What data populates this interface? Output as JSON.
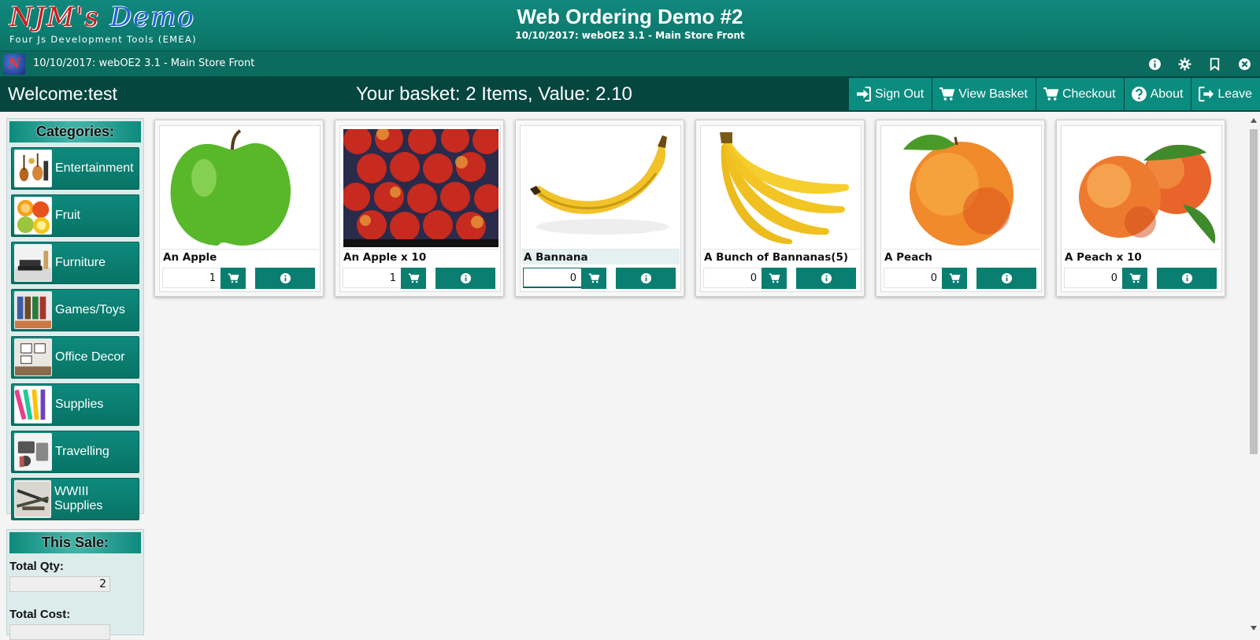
{
  "header": {
    "logo_main": "NJM's",
    "logo_accent": "Demo",
    "logo_sub": "Four Js Development Tools (EMEA)",
    "app_title": "Web Ordering Demo #2",
    "app_subtitle": "10/10/2017: webOE2 3.1 - Main Store Front"
  },
  "window": {
    "title": "10/10/2017: webOE2 3.1 - Main Store Front",
    "icon_letter": "N",
    "actions": [
      "info-icon",
      "gear-icon",
      "bookmark-icon",
      "close-icon"
    ]
  },
  "toolbar": {
    "welcome": "Welcome:test",
    "basket_summary": "Your basket: 2 Items, Value: 2.10",
    "buttons": [
      {
        "label": "Sign Out",
        "icon": "sign-in-icon"
      },
      {
        "label": "View Basket",
        "icon": "cart-icon"
      },
      {
        "label": "Checkout",
        "icon": "cart-icon"
      },
      {
        "label": "About",
        "icon": "question-icon"
      },
      {
        "label": "Leave",
        "icon": "sign-out-icon"
      }
    ]
  },
  "sidebar": {
    "categories_title": "Categories:",
    "categories": [
      {
        "label": "Entertainment"
      },
      {
        "label": "Fruit"
      },
      {
        "label": "Furniture"
      },
      {
        "label": "Games/Toys"
      },
      {
        "label": "Office Decor"
      },
      {
        "label": "Supplies"
      },
      {
        "label": "Travelling"
      },
      {
        "label": "WWIII Supplies"
      }
    ],
    "sale_title": "This Sale:",
    "total_qty_label": "Total Qty:",
    "total_qty_value": "2",
    "total_cost_label": "Total Cost:"
  },
  "products": [
    {
      "name": "An Apple",
      "qty": "1",
      "image": "green-apple"
    },
    {
      "name": "An Apple x 10",
      "qty": "1",
      "image": "red-apples-crate"
    },
    {
      "name": "A Bannana",
      "qty": "0",
      "image": "banana"
    },
    {
      "name": "A Bunch of Bannanas(5)",
      "qty": "0",
      "image": "banana-bunch"
    },
    {
      "name": "A Peach",
      "qty": "0",
      "image": "peach"
    },
    {
      "name": "A Peach x 10",
      "qty": "0",
      "image": "peaches"
    }
  ],
  "colors": {
    "teal": "#0a7e71",
    "dark_teal": "#05463f",
    "panel_bg": "#dceceb"
  }
}
